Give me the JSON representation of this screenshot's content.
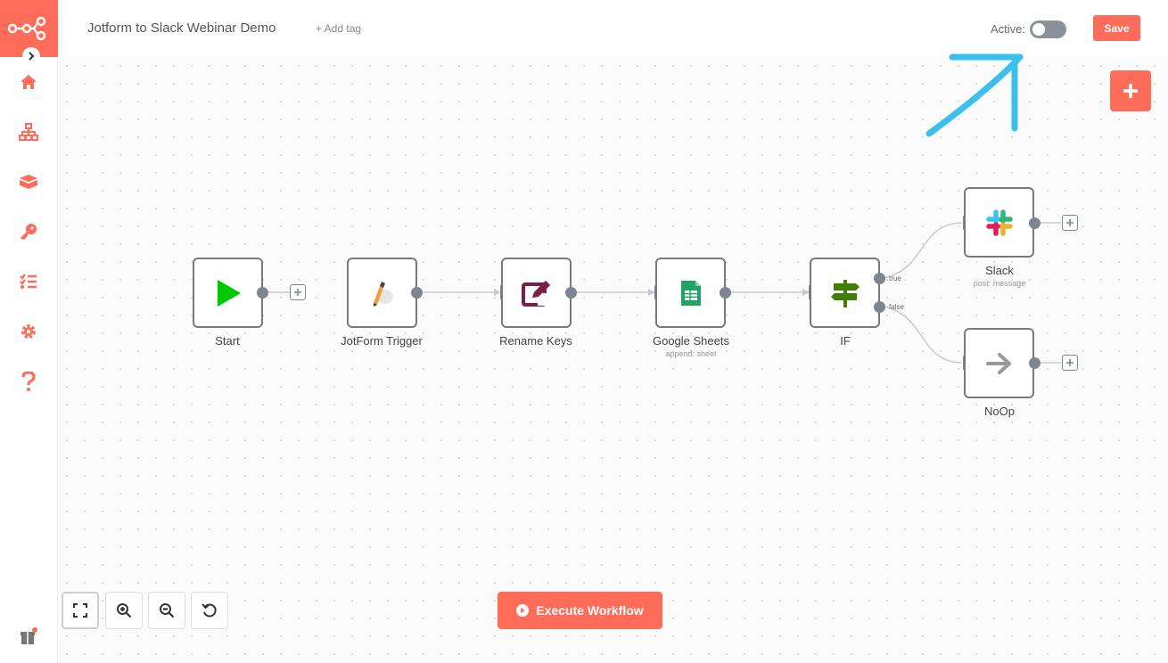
{
  "header": {
    "workflow_title": "Jotform to Slack Webinar Demo",
    "add_tag_label": "+ Add tag",
    "active_label": "Active:",
    "active": false,
    "save_label": "Save"
  },
  "sidebar": {
    "items": [
      {
        "icon": "home-icon"
      },
      {
        "icon": "workflows-icon"
      },
      {
        "icon": "executions-icon"
      },
      {
        "icon": "credentials-icon"
      },
      {
        "icon": "executions-list-icon"
      },
      {
        "icon": "settings-icon"
      },
      {
        "icon": "help-icon"
      },
      {
        "icon": "gift-icon"
      }
    ]
  },
  "nodes": [
    {
      "name": "Start",
      "subtitle": ""
    },
    {
      "name": "JotForm Trigger",
      "subtitle": ""
    },
    {
      "name": "Rename Keys",
      "subtitle": ""
    },
    {
      "name": "Google Sheets",
      "subtitle": "append: sheet"
    },
    {
      "name": "IF",
      "subtitle": "",
      "outputs": [
        "true",
        "false"
      ]
    },
    {
      "name": "Slack",
      "subtitle": "post: message"
    },
    {
      "name": "NoOp",
      "subtitle": ""
    }
  ],
  "controls": {
    "execute_label": "Execute Workflow"
  },
  "colors": {
    "brand": "#ff6d5a",
    "annotation": "#3bbfee",
    "port": "#7d8590"
  }
}
